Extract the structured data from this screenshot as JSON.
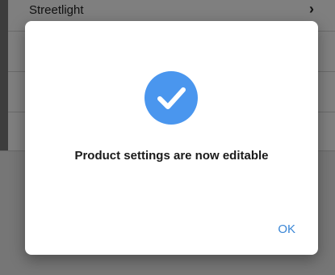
{
  "background_list": {
    "items": [
      {
        "label": "Streetlight"
      }
    ]
  },
  "dialog": {
    "icon": "check-circle-icon",
    "message": "Product settings are now editable",
    "ok_label": "OK"
  },
  "colors": {
    "accent": "#4a96ee",
    "button_text": "#3a86d6"
  }
}
